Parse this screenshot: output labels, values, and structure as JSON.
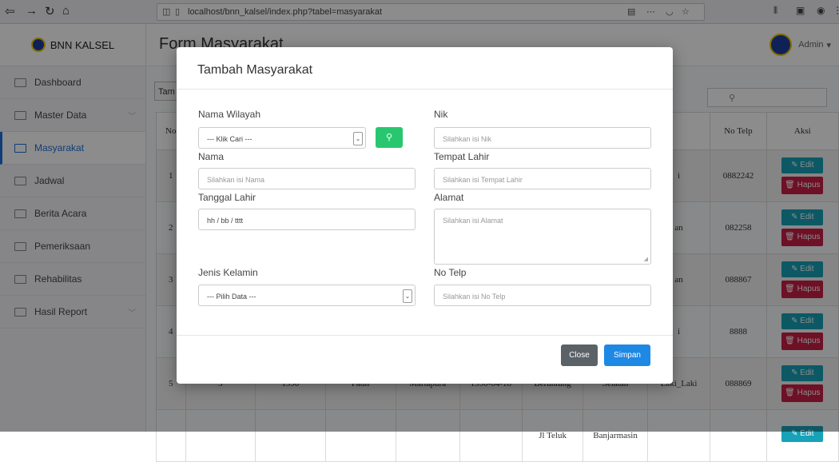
{
  "browser": {
    "url": "localhost/bnn_kalsel/index.php?tabel=masyarakat"
  },
  "sidebar": {
    "brand": "BNN KALSEL",
    "items": [
      {
        "label": "Dashboard"
      },
      {
        "label": "Master Data"
      },
      {
        "label": "Masyarakat"
      },
      {
        "label": "Jadwal"
      },
      {
        "label": "Berita Acara"
      },
      {
        "label": "Pemeriksaan"
      },
      {
        "label": "Rehabilitas"
      },
      {
        "label": "Hasil Report"
      }
    ]
  },
  "header": {
    "title": "Form Masyarakat",
    "user": "Admin"
  },
  "toolbar": {
    "add_label": "Tam"
  },
  "table": {
    "headers": {
      "no": "No",
      "telp": "No Telp",
      "aksi": "Aksi"
    },
    "rows": [
      {
        "no": "1",
        "col_a": "i",
        "telp": "0882242"
      },
      {
        "no": "2",
        "col_a": "an",
        "telp": "082258"
      },
      {
        "no": "3",
        "col_a": "an",
        "telp": "088867"
      },
      {
        "no": "4",
        "col_a": "i",
        "telp": "8888"
      },
      {
        "no": "5",
        "id": "5",
        "year": "1990",
        "nama": "Fadil",
        "tempat": "Martapura",
        "tgl": "1990-04-18",
        "wilayah": "Beruntung",
        "alamat": "Selatan",
        "jk": "Laki_Laki",
        "telp": "088869"
      },
      {
        "wilayah": "Jl Teluk",
        "alamat": "Banjarmasin"
      }
    ],
    "edit_label": "Edit",
    "delete_label": "Hapus"
  },
  "modal": {
    "title": "Tambah Masyarakat",
    "fields": {
      "nama_wilayah": {
        "label": "Nama Wilayah",
        "value": "--- Klik Cari ---"
      },
      "nik": {
        "label": "Nik",
        "placeholder": "Silahkan isi Nik"
      },
      "nama": {
        "label": "Nama",
        "placeholder": "Silahkan isi Nama"
      },
      "tempat_lahir": {
        "label": "Tempat Lahir",
        "placeholder": "Silahkan isi Tempat Lahir"
      },
      "tanggal_lahir": {
        "label": "Tanggal Lahir",
        "placeholder": "hh / bb / tttt"
      },
      "alamat": {
        "label": "Alamat",
        "placeholder": "Silahkan isi Alamat"
      },
      "jenis_kelamin": {
        "label": "Jenis Kelamin",
        "value": "--- Pilih Data ---"
      },
      "no_telp": {
        "label": "No Telp",
        "placeholder": "Silahkan isi No Telp"
      }
    },
    "close_label": "Close",
    "save_label": "Simpan"
  }
}
